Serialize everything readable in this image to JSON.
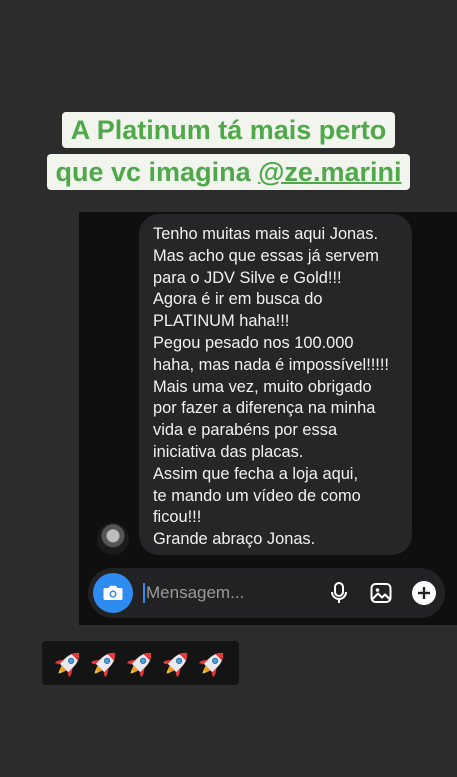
{
  "headline": {
    "line1": "A Platinum tá mais perto",
    "line2_prefix": "que vc imagina ",
    "line2_mention": "@ze.marini"
  },
  "message": {
    "lines": [
      "Tenho muitas mais aqui Jonas.",
      "Mas acho que essas já servem",
      "para o JDV Silve e Gold!!!",
      "Agora é ir em busca do",
      "PLATINUM haha!!!",
      "Pegou pesado nos 100.000",
      "haha, mas nada é impossível!!!!!",
      "Mais uma vez, muito obrigado",
      "por fazer a diferença na minha",
      "vida e parabéns por essa",
      "iniciativa das placas.",
      "Assim que fecha a loja aqui,",
      "te mando um vídeo de como",
      "ficou!!!",
      "Grande abraço Jonas."
    ]
  },
  "composer": {
    "placeholder": "Mensagem...",
    "camera_icon": "camera-icon",
    "mic_icon": "microphone-icon",
    "gallery_icon": "image-icon",
    "add_icon": "plus-icon"
  },
  "stickers": {
    "emoji": "rocket",
    "count": 5
  },
  "colors": {
    "headline_text": "#4fa84a",
    "headline_bg": "#f2f5ee",
    "background": "#2c2c2c",
    "chat_panel": "#0f0f10",
    "bubble": "#262629",
    "accent_blue": "#2e8bf0"
  }
}
